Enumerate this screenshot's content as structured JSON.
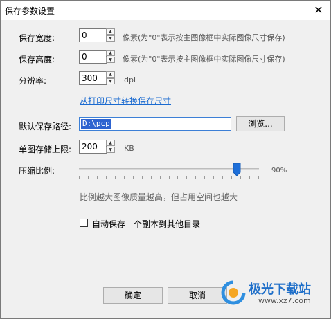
{
  "window": {
    "title": "保存参数设置",
    "close_glyph": "✕"
  },
  "fields": {
    "width": {
      "label": "保存宽度:",
      "value": "0",
      "hint": "像素(为\"0\"表示按主图像框中实际图像尺寸保存)"
    },
    "height": {
      "label": "保存高度:",
      "value": "0",
      "hint": "像素(为\"0\"表示按主图像框中实际图像尺寸保存)"
    },
    "resolution": {
      "label": "分辨率:",
      "value": "300",
      "unit": "dpi"
    },
    "convert_link": "从打印尺寸转换保存尺寸",
    "path": {
      "label": "默认保存路径:",
      "value": "D:\\pcp",
      "browse_label": "浏览..."
    },
    "max_size": {
      "label": "单图存储上限:",
      "value": "200",
      "unit": "KB"
    },
    "compression": {
      "label": "压缩比例:",
      "value": 0.9,
      "value_text": "90%",
      "note": "比例越大图像质量越高，但占用空间也越大"
    },
    "auto_copy": {
      "label": "自动保存一个副本到其他目录",
      "checked": false
    }
  },
  "buttons": {
    "ok": "确定",
    "cancel": "取消"
  },
  "colors": {
    "slider_thumb": "#1e6fd9",
    "link": "#1a6ad0"
  },
  "watermark": {
    "text": "极光下载站",
    "url": "www.xz7.com"
  }
}
